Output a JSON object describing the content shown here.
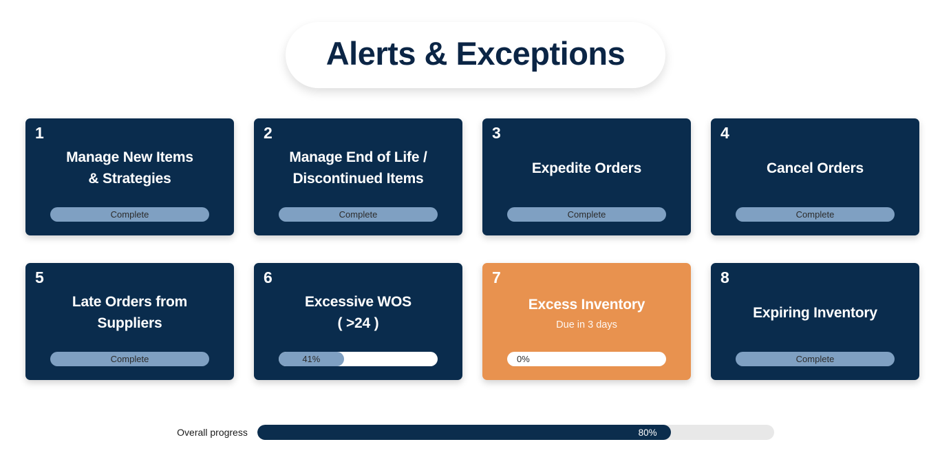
{
  "header": {
    "title": "Alerts & Exceptions"
  },
  "colors": {
    "card_default": "#0a2c4d",
    "card_accent": "#e8924f",
    "status_pill": "#7fa0c2",
    "progress_fill": "#7fa0c2",
    "progress_track": "#ffffff",
    "overall_fill": "#0b2d4d",
    "overall_track": "#e8e8e8",
    "page_background": "#ffffff",
    "title_text": "#0b2545"
  },
  "cards": [
    {
      "number": "1",
      "title": "Manage New Items\n& Strategies",
      "subtitle": "",
      "status_type": "complete",
      "status_label": "Complete",
      "percent": 100,
      "accent": false
    },
    {
      "number": "2",
      "title": "Manage End of Life /\nDiscontinued Items",
      "subtitle": "",
      "status_type": "complete",
      "status_label": "Complete",
      "percent": 100,
      "accent": false
    },
    {
      "number": "3",
      "title": "Expedite Orders",
      "subtitle": "",
      "status_type": "complete",
      "status_label": "Complete",
      "percent": 100,
      "accent": false
    },
    {
      "number": "4",
      "title": "Cancel Orders",
      "subtitle": "",
      "status_type": "complete",
      "status_label": "Complete",
      "percent": 100,
      "accent": false
    },
    {
      "number": "5",
      "title": "Late Orders from\nSuppliers",
      "subtitle": "",
      "status_type": "complete",
      "status_label": "Complete",
      "percent": 100,
      "accent": false
    },
    {
      "number": "6",
      "title": "Excessive WOS\n( >24 )",
      "subtitle": "",
      "status_type": "progress",
      "status_label": "41%",
      "percent": 41,
      "accent": false
    },
    {
      "number": "7",
      "title": "Excess Inventory",
      "subtitle": "Due in 3 days",
      "status_type": "progress",
      "status_label": "0%",
      "percent": 0,
      "accent": true
    },
    {
      "number": "8",
      "title": "Expiring Inventory",
      "subtitle": "",
      "status_type": "complete",
      "status_label": "Complete",
      "percent": 100,
      "accent": false
    }
  ],
  "overall": {
    "label": "Overall progress",
    "value_label": "80%",
    "percent": 80
  }
}
